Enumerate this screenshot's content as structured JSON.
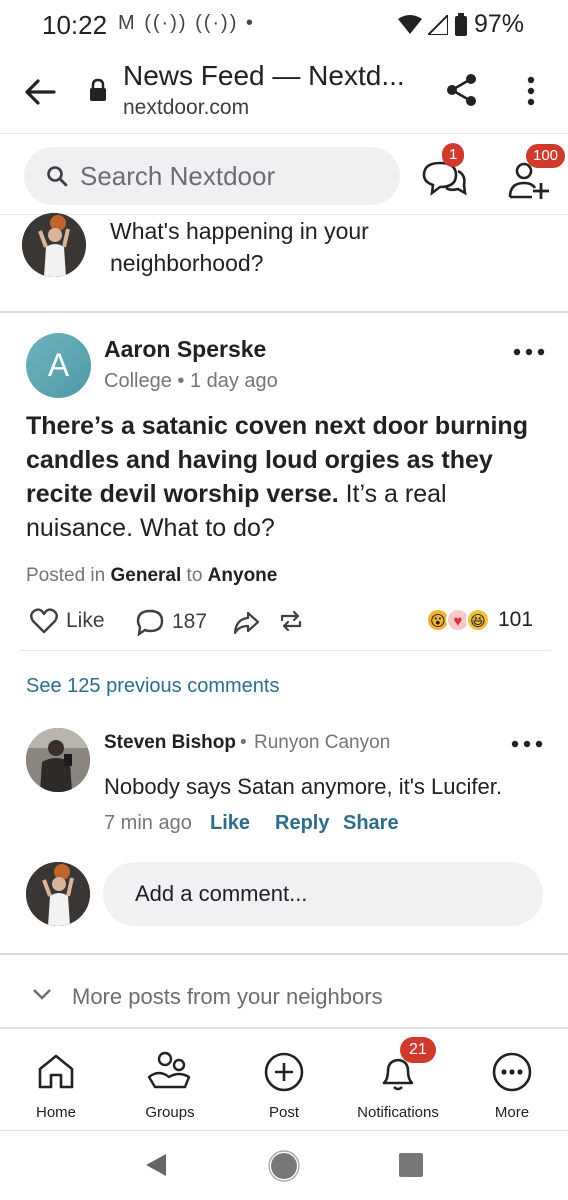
{
  "status_bar": {
    "time": "10:22",
    "left_icons": "M ((·)) ((·)) •",
    "battery": "97%"
  },
  "browser": {
    "title": "News Feed — Nextd...",
    "url": "nextdoor.com"
  },
  "search": {
    "placeholder": "Search Nextdoor",
    "chat_badge": "1",
    "friends_badge": "100"
  },
  "composer": {
    "prompt": "What's happening in your neighborhood?"
  },
  "post": {
    "avatar_initial": "A",
    "author": "Aaron Sperske",
    "meta": "College • 1 day ago",
    "body_bold": "There’s a satanic coven next door burning candles and having loud orgies as they recite devil worship verse.",
    "body_rest": " It’s a real nuisance. What to do?",
    "posted_in_prefix": "Posted in ",
    "category": "General",
    "to_word": " to ",
    "audience": "Anyone",
    "like_label": "Like",
    "comment_count": "187",
    "reaction_count": "101"
  },
  "comments": {
    "see_previous": "See 125 previous comments",
    "items": [
      {
        "name": "Steven Bishop",
        "separator": " •",
        "location": "Runyon Canyon",
        "text": "Nobody says Satan anymore, it's Lucifer.",
        "time": "7 min ago",
        "like": "Like",
        "reply": "Reply",
        "share": "Share"
      }
    ],
    "add_placeholder": "Add a comment..."
  },
  "more_posts": "More posts from your neighbors",
  "bottom_nav": {
    "home": "Home",
    "groups": "Groups",
    "post": "Post",
    "notifications": "Notifications",
    "notifications_badge": "21",
    "more": "More"
  },
  "colors": {
    "link": "#2e6c8a",
    "badge": "#d03a2c",
    "avatar_gradient": "#5fa6b2"
  }
}
